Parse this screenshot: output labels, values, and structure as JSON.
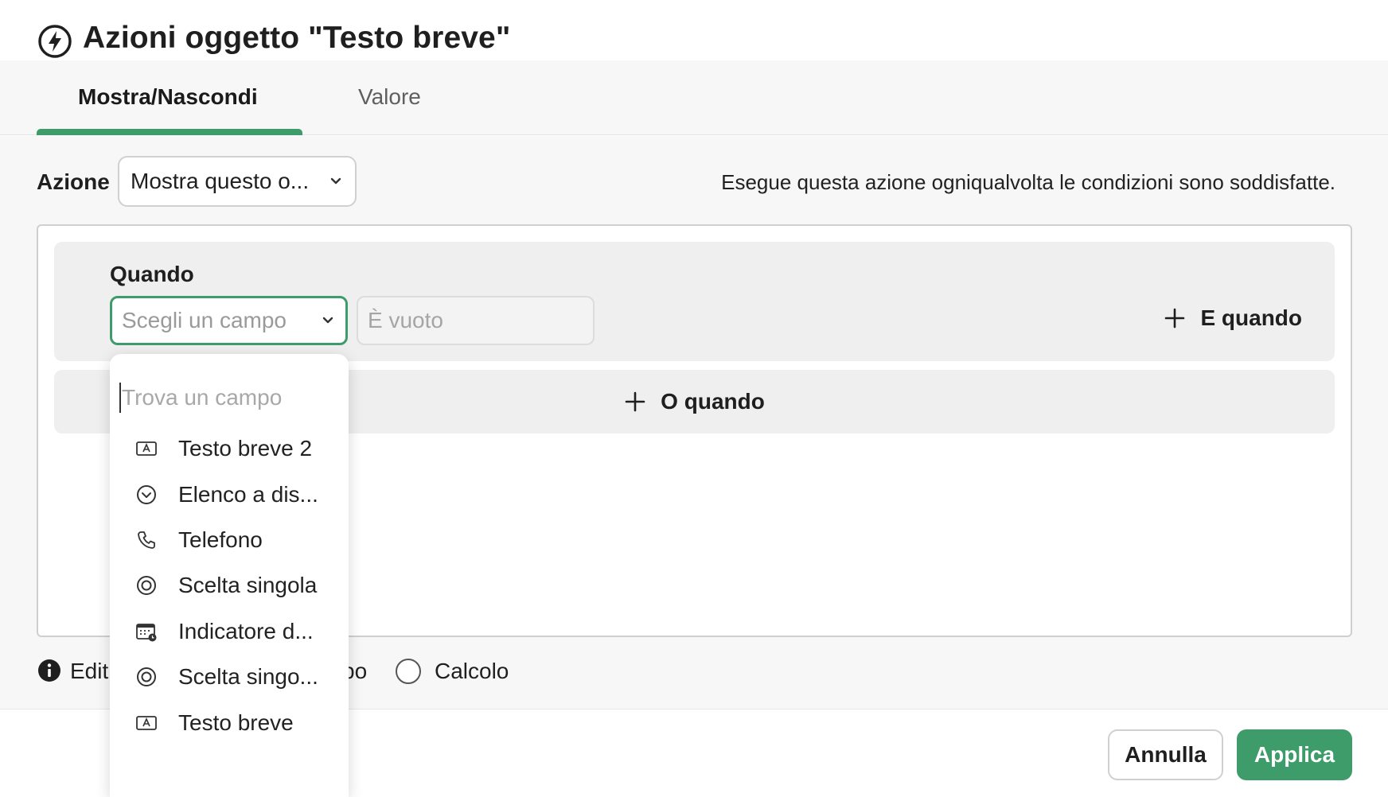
{
  "dialog": {
    "title": "Azioni oggetto \"Testo breve\"",
    "title_icon": "lightning-icon"
  },
  "tabs": [
    {
      "label": "Mostra/Nascondi",
      "active": true
    },
    {
      "label": "Valore",
      "active": false
    }
  ],
  "action": {
    "label": "Azione",
    "selected": "Mostra questo o...",
    "hint": "Esegue questa azione ogniqualvolta le condizioni sono soddisfatte."
  },
  "condition": {
    "when_label": "Quando",
    "field_placeholder": "Scegli un campo",
    "operator_placeholder": "È vuoto",
    "and_when": "E quando",
    "or_when": "O quando"
  },
  "dropdown": {
    "search_placeholder": "Trova un campo",
    "items": [
      {
        "label": "Testo breve 2",
        "icon": "text-field-icon"
      },
      {
        "label": "Elenco a dis...",
        "icon": "dropdown-circle-icon"
      },
      {
        "label": "Telefono",
        "icon": "phone-icon"
      },
      {
        "label": "Scelta singola",
        "icon": "radio-target-icon"
      },
      {
        "label": "Indicatore d...",
        "icon": "calendar-clock-icon"
      },
      {
        "label": "Scelta singo...",
        "icon": "radio-target-icon"
      },
      {
        "label": "Testo breve",
        "icon": "text-field-icon"
      }
    ]
  },
  "options": {
    "edit_partial": "Edit",
    "po_partial": "po",
    "calc_label": "Calcolo"
  },
  "footer": {
    "cancel": "Annulla",
    "apply": "Applica"
  },
  "colors": {
    "accent": "#3e9b6a",
    "panel": "#efefef"
  }
}
